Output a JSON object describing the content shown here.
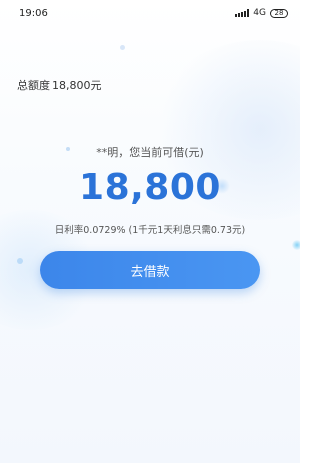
{
  "status_bar": {
    "time": "19:06",
    "network": "4G",
    "battery": "28"
  },
  "quota": {
    "label": "总额度",
    "value": "18,800元"
  },
  "available": {
    "label": "**明，您当前可借(元)",
    "amount": "18,800",
    "rate_text": "日利率0.0729% (1千元1天利息只需0.73元)"
  },
  "actions": {
    "borrow_label": "去借款"
  },
  "colors": {
    "accent": "#2b73d8",
    "button": "#4a96f2"
  }
}
